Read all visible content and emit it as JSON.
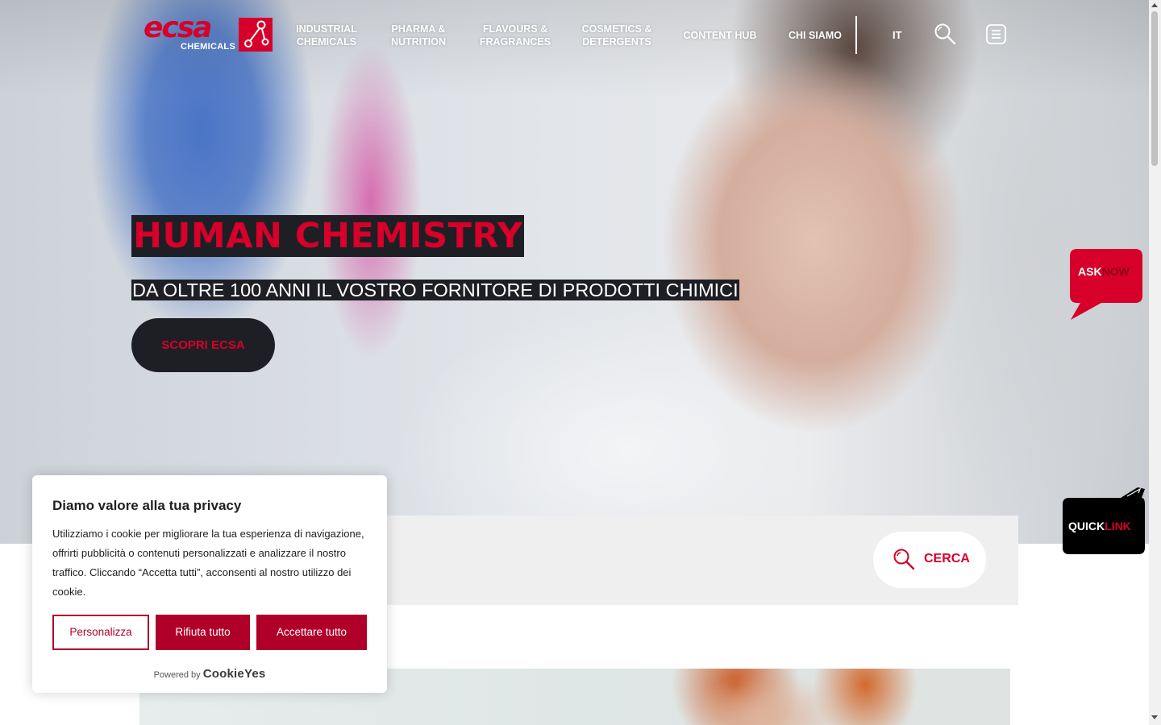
{
  "brand": {
    "logo_text": "ecsa",
    "logo_sub": "CHEMICALS",
    "color_primary": "#d6002a",
    "color_dark": "#1e1f24"
  },
  "nav": {
    "items": [
      {
        "line1": "INDUSTRIAL",
        "line2": "CHEMICALS"
      },
      {
        "line1": "PHARMA &",
        "line2": "NUTRITION"
      },
      {
        "line1": "FLAVOURS &",
        "line2": "FRAGRANCES"
      },
      {
        "line1": "COSMETICS &",
        "line2": "DETERGENTS"
      },
      {
        "line1": "CONTENT HUB",
        "line2": ""
      },
      {
        "line1": "CHI SIAMO",
        "line2": ""
      }
    ],
    "language": "IT",
    "icons": [
      "search-icon",
      "menu-icon"
    ]
  },
  "hero": {
    "title": "HUMAN CHEMISTRY",
    "subtitle": "DA OLTRE 100 ANNI IL VOSTRO FORNITORE DI PRODOTTI CHIMICI",
    "cta_label": "SCOPRI ECSA"
  },
  "ask_now": {
    "part1": "ASK",
    "part2": "NOW"
  },
  "quicklink": {
    "part1": "QUICK",
    "part2": "LINK"
  },
  "search": {
    "button_label": "CERCA"
  },
  "cookie_banner": {
    "title": "Diamo valore alla tua privacy",
    "text": "Utilizziamo i cookie per migliorare la tua esperienza di navigazione, offrirti pubblicità o contenuti personalizzati e analizzare il nostro traffico. Cliccando “Accetta tutti”, acconsenti al nostro utilizzo dei cookie.",
    "btn_customize": "Personalizza",
    "btn_reject": "Rifiuta tutto",
    "btn_accept": "Accettare tutto",
    "powered_by": "Powered by",
    "powered_brand": "CookieYes"
  }
}
